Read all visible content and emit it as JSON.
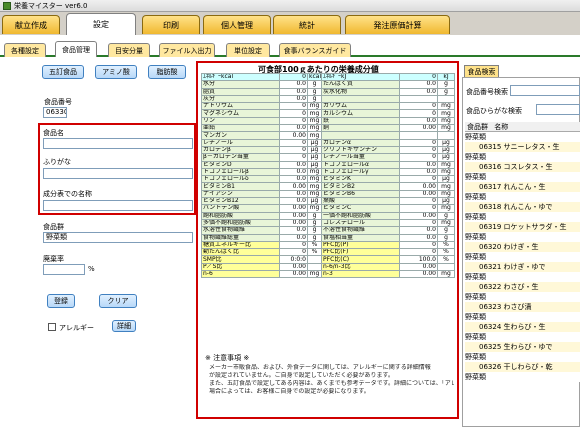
{
  "window": {
    "title": "栄養マイスター ver6.0"
  },
  "main_tabs": [
    "献立作成",
    "設定",
    "印刷",
    "個人管理",
    "統計",
    "発注原価計算"
  ],
  "sub_tabs": [
    "各種設定",
    "食品管理",
    "目安分量",
    "ファイル入出力",
    "単位設定",
    "食事バランスガイド"
  ],
  "left": {
    "buttons": [
      "五訂食品",
      "アミノ酸",
      "脂肪酸"
    ],
    "food_no_label": "食品番号",
    "food_no": "06330",
    "name_label": "食品名",
    "furigana_label": "ふりがな",
    "table_name_label": "成分表での名称",
    "group_label": "食品群",
    "group_value": "野菜類",
    "waste_label": "廃棄率",
    "waste_unit": "%",
    "register": "登録",
    "clear": "クリア",
    "allergy_label": "アレルギー",
    "detail": "詳細"
  },
  "table": {
    "title": "可食部100ｇあたりの栄養成分値",
    "rows": [
      [
        "ｴﾈﾙｷﾞｰkcal",
        "0",
        "kcal",
        "ｴﾈﾙｷﾞｰkJ",
        "0",
        "kJ"
      ],
      [
        "水分",
        "0.0",
        "g",
        "たんぱく質",
        "0.0",
        "g"
      ],
      [
        "脂質",
        "0.0",
        "g",
        "炭水化物",
        "0.0",
        "g"
      ],
      [
        "灰分",
        "0.0",
        "g",
        "",
        "",
        ""
      ],
      [
        "ナトリウム",
        "0",
        "mg",
        "カリウム",
        "0",
        "mg"
      ],
      [
        "マグネシウム",
        "0",
        "mg",
        "カルシウム",
        "0",
        "mg"
      ],
      [
        "リン",
        "0",
        "mg",
        "鉄",
        "0.0",
        "mg"
      ],
      [
        "亜鉛",
        "0.0",
        "mg",
        "銅",
        "0.00",
        "mg"
      ],
      [
        "マンガン",
        "0.00",
        "mg",
        "",
        "",
        ""
      ],
      [
        "レチノール",
        "0",
        "μg",
        "カロテンα",
        "0",
        "μg"
      ],
      [
        "カロテンβ",
        "0",
        "μg",
        "クリプトキサンチン",
        "0",
        "μg"
      ],
      [
        "β－カロテン当量",
        "0",
        "μg",
        "レチノール当量",
        "0",
        "μg"
      ],
      [
        "ビタミンD",
        "0.0",
        "μg",
        "トコフェロールα",
        "0.0",
        "mg"
      ],
      [
        "トコフェロールβ",
        "0.0",
        "mg",
        "トコフェロールγ",
        "0.0",
        "mg"
      ],
      [
        "トコフェロールδ",
        "0.0",
        "mg",
        "ビタミンK",
        "0",
        "μg"
      ],
      [
        "ビタミンB1",
        "0.00",
        "mg",
        "ビタミンB2",
        "0.00",
        "mg"
      ],
      [
        "ナイアシン",
        "0.0",
        "mg",
        "ビタミンB6",
        "0.00",
        "mg"
      ],
      [
        "ビタミンB12",
        "0.0",
        "μg",
        "葉酸",
        "0",
        "μg"
      ],
      [
        "パントテン酸",
        "0.00",
        "mg",
        "ビタミンC",
        "0",
        "mg"
      ],
      [
        "飽和脂肪酸",
        "0.00",
        "g",
        "一価不飽和脂肪酸",
        "0.00",
        "g"
      ],
      [
        "多価不飽和脂肪酸",
        "0.00",
        "g",
        "コレステロール",
        "0",
        "mg"
      ],
      [
        "水溶性食物繊維",
        "0.0",
        "g",
        "不溶性食物繊維",
        "0.0",
        "g"
      ],
      [
        "食物繊維総量",
        "0.0",
        "g",
        "食塩相当量",
        "0.0",
        "g"
      ],
      [
        "糖質エネルギー比",
        "0",
        "%",
        "PFC比(P)",
        "0",
        "%"
      ],
      [
        "動たんぱく比",
        "0",
        "%",
        "PFC比(F)",
        "0",
        "%"
      ],
      [
        "SMP比",
        "0:0:0",
        "",
        "PFC比(C)",
        "100.0",
        "%"
      ],
      [
        "P／S比",
        "0.00",
        "",
        "n-6/n-3比",
        "0.00",
        ""
      ],
      [
        "n-6",
        "0.00",
        "mg",
        "n-3",
        "0.00",
        "mg"
      ]
    ],
    "note_title": "※ 注意事項 ※",
    "note_lines": [
      "メーカー市販食品、および、外食データに関しては、アレルギーに関する詳細情報",
      "が設定されていません。ご自身で設定していただく必要があります。",
      "また、五訂食品で設定してある内容は、あくまでも参考データです。詳細については、「アレルギー設定画面」で内容をご確認ください。",
      "場合によっては、お客様ご自身での設定が必要になります。"
    ]
  },
  "right": {
    "tab": "食品検索",
    "no_search": "食品番号検索",
    "kana_search": "食品ひらがな検索",
    "col1": "食品群",
    "col2": "名称",
    "col_sub": "食品群",
    "items": [
      {
        "g": "野菜類",
        "n": ""
      },
      {
        "g": "",
        "n": "06315 サニーレタス・生"
      },
      {
        "g": "野菜類",
        "n": ""
      },
      {
        "g": "",
        "n": "06316 コスレタス・生"
      },
      {
        "g": "野菜類",
        "n": ""
      },
      {
        "g": "",
        "n": "06317 れんこん・生"
      },
      {
        "g": "野菜類",
        "n": ""
      },
      {
        "g": "",
        "n": "06318 れんこん・ゆで"
      },
      {
        "g": "野菜類",
        "n": ""
      },
      {
        "g": "",
        "n": "06319 ロケットサラダ・生"
      },
      {
        "g": "野菜類",
        "n": ""
      },
      {
        "g": "",
        "n": "06320 わけぎ・生"
      },
      {
        "g": "野菜類",
        "n": ""
      },
      {
        "g": "",
        "n": "06321 わけぎ・ゆで"
      },
      {
        "g": "野菜類",
        "n": ""
      },
      {
        "g": "",
        "n": "06322 わさび・生"
      },
      {
        "g": "野菜類",
        "n": ""
      },
      {
        "g": "",
        "n": "06323 わさび漬"
      },
      {
        "g": "野菜類",
        "n": ""
      },
      {
        "g": "",
        "n": "06324 生わらび・生"
      },
      {
        "g": "野菜類",
        "n": ""
      },
      {
        "g": "",
        "n": "06325 生わらび・ゆで"
      },
      {
        "g": "野菜類",
        "n": ""
      },
      {
        "g": "",
        "n": "06326 干しわらび・乾"
      },
      {
        "g": "野菜類",
        "n": ""
      }
    ]
  }
}
